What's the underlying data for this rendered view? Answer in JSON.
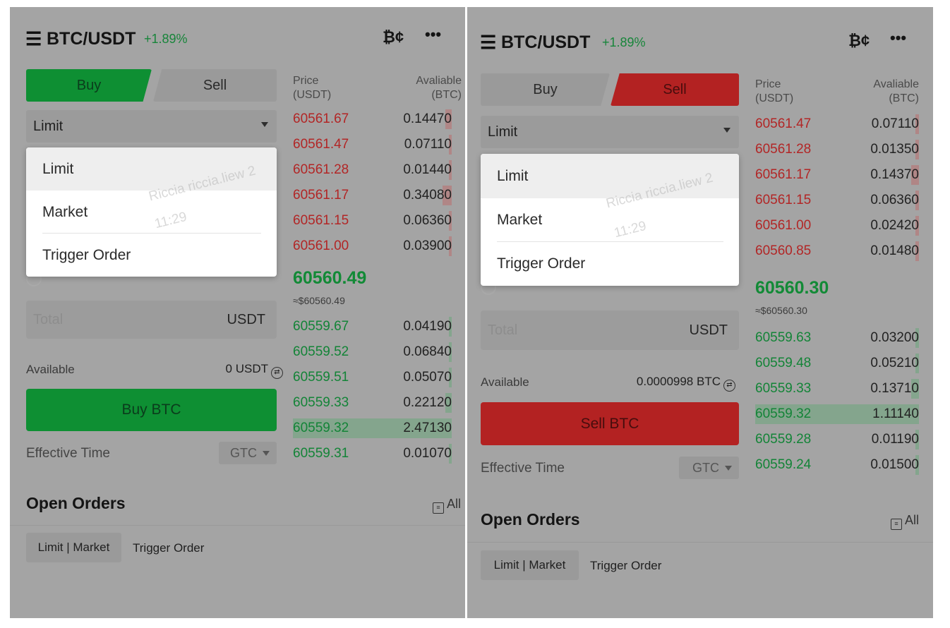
{
  "panels": [
    {
      "header": {
        "pair": "BTC/USDT",
        "change": "+1.89%"
      },
      "side_tabs": {
        "buy": "Buy",
        "sell": "Sell",
        "active": "buy"
      },
      "order_type": {
        "selected": "Limit",
        "options": [
          "Limit",
          "Market",
          "Trigger Order"
        ]
      },
      "watermark": {
        "name": "Riccia riccia.liew 2",
        "time": "11:29"
      },
      "total": {
        "placeholder": "Total",
        "unit": "USDT"
      },
      "available": {
        "label": "Available",
        "value": "0 USDT"
      },
      "action_button": "Buy BTC",
      "effective_time": {
        "label": "Effective Time",
        "value": "GTC"
      },
      "orderbook": {
        "price_header": "Price\n(USDT)",
        "qty_header": "Avaliable\n(BTC)",
        "asks": [
          {
            "price": "60561.67",
            "qty": "0.14470",
            "depth": 0.1
          },
          {
            "price": "60561.47",
            "qty": "0.07110",
            "depth": 0.04
          },
          {
            "price": "60561.28",
            "qty": "0.01440",
            "depth": 0.01
          },
          {
            "price": "60561.17",
            "qty": "0.34080",
            "depth": 0.15
          },
          {
            "price": "60561.15",
            "qty": "0.06360",
            "depth": 0.04
          },
          {
            "price": "60561.00",
            "qty": "0.03900",
            "depth": 0.02
          }
        ],
        "mid_price": "60560.49",
        "mid_fiat": "≈$60560.49",
        "bids": [
          {
            "price": "60559.67",
            "qty": "0.04190",
            "depth": 0.02,
            "hl": false
          },
          {
            "price": "60559.52",
            "qty": "0.06840",
            "depth": 0.03,
            "hl": false
          },
          {
            "price": "60559.51",
            "qty": "0.05070",
            "depth": 0.03,
            "hl": false
          },
          {
            "price": "60559.33",
            "qty": "0.22120",
            "depth": 0.1,
            "hl": false
          },
          {
            "price": "60559.32",
            "qty": "2.47130",
            "depth": 1.0,
            "hl": true
          },
          {
            "price": "60559.31",
            "qty": "0.01070",
            "depth": 0.01,
            "hl": false
          }
        ]
      },
      "open_orders": {
        "title": "Open Orders",
        "all": "All",
        "tab1": "Limit | Market",
        "tab2": "Trigger Order"
      }
    },
    {
      "header": {
        "pair": "BTC/USDT",
        "change": "+1.89%"
      },
      "side_tabs": {
        "buy": "Buy",
        "sell": "Sell",
        "active": "sell"
      },
      "order_type": {
        "selected": "Limit",
        "options": [
          "Limit",
          "Market",
          "Trigger Order"
        ]
      },
      "watermark": {
        "name": "Riccia riccia.liew 2",
        "time": "11:29"
      },
      "total": {
        "placeholder": "Total",
        "unit": "USDT"
      },
      "available": {
        "label": "Available",
        "value": "0.0000998 BTC"
      },
      "action_button": "Sell BTC",
      "effective_time": {
        "label": "Effective Time",
        "value": "GTC"
      },
      "orderbook": {
        "price_header": "Price\n(USDT)",
        "qty_header": "Avaliable\n(BTC)",
        "asks": [
          {
            "price": "60561.47",
            "qty": "0.07110",
            "depth": 0.05
          },
          {
            "price": "60561.28",
            "qty": "0.01350",
            "depth": 0.01
          },
          {
            "price": "60561.17",
            "qty": "0.14370",
            "depth": 0.12
          },
          {
            "price": "60561.15",
            "qty": "0.06360",
            "depth": 0.05
          },
          {
            "price": "60561.00",
            "qty": "0.02420",
            "depth": 0.02
          },
          {
            "price": "60560.85",
            "qty": "0.01480",
            "depth": 0.01
          }
        ],
        "mid_price": "60560.30",
        "mid_fiat": "≈$60560.30",
        "bids": [
          {
            "price": "60559.63",
            "qty": "0.03200",
            "depth": 0.03,
            "hl": false
          },
          {
            "price": "60559.48",
            "qty": "0.05210",
            "depth": 0.05,
            "hl": false
          },
          {
            "price": "60559.33",
            "qty": "0.13710",
            "depth": 0.12,
            "hl": false
          },
          {
            "price": "60559.32",
            "qty": "1.11140",
            "depth": 1.0,
            "hl": true
          },
          {
            "price": "60559.28",
            "qty": "0.01190",
            "depth": 0.01,
            "hl": false
          },
          {
            "price": "60559.24",
            "qty": "0.01500",
            "depth": 0.01,
            "hl": false
          }
        ]
      },
      "open_orders": {
        "title": "Open Orders",
        "all": "All",
        "tab1": "Limit | Market",
        "tab2": "Trigger Order"
      }
    }
  ]
}
